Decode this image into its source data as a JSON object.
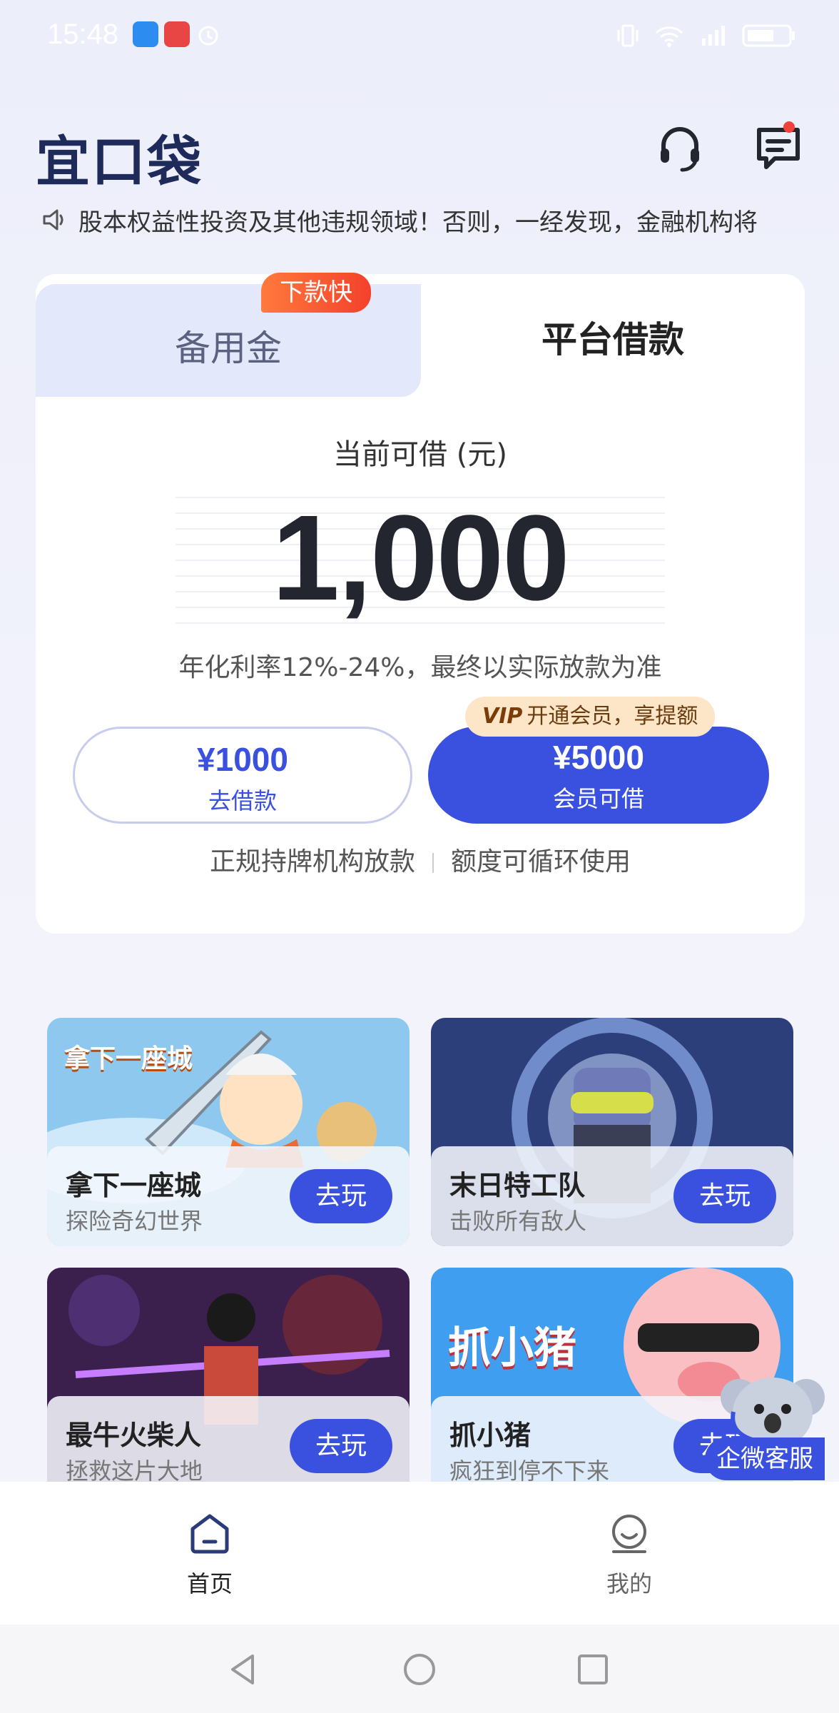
{
  "status_bar": {
    "time": "15:48"
  },
  "header": {
    "logo": "宜口袋",
    "notification_dot": true
  },
  "marquee": {
    "text": "股本权益性投资及其他违规领域！否则，一经发现，金融机构将"
  },
  "loan_card": {
    "tab_standby": "备用金",
    "tab_standby_badge": "下款快",
    "tab_platform": "平台借款",
    "available_label": "当前可借 (元)",
    "amount": "1,000",
    "rate_text": "年化利率12%-24%，最终以实际放款为准",
    "btn_borrow_amount": "¥1000",
    "btn_borrow_label": "去借款",
    "vip_badge_prefix": "VIP",
    "vip_badge_text": "开通会员，享提额",
    "btn_member_amount": "¥5000",
    "btn_member_label": "会员可借",
    "feature_1": "正规持牌机构放款",
    "feature_2": "额度可循环使用"
  },
  "games": [
    {
      "art_text": "拿下一座城",
      "title": "拿下一座城",
      "desc": "探险奇幻世界",
      "button": "去玩"
    },
    {
      "art_text": "",
      "title": "末日特工队",
      "desc": "击败所有敌人",
      "button": "去玩"
    },
    {
      "art_text": "",
      "title": "最牛火柴人",
      "desc": "拯救这片大地",
      "button": "去玩"
    },
    {
      "art_text": "抓小猪",
      "title": "抓小猪",
      "desc": "疯狂到停不下来",
      "button": "去玩"
    }
  ],
  "customer_service": {
    "label": "企微客服"
  },
  "bottom_nav": {
    "home": "首页",
    "mine": "我的"
  },
  "colors": {
    "primary": "#3a51e0",
    "badge_orange": "#f3412b",
    "vip_bg": "#fde5c8",
    "tab_bg": "#e3e8fb"
  }
}
